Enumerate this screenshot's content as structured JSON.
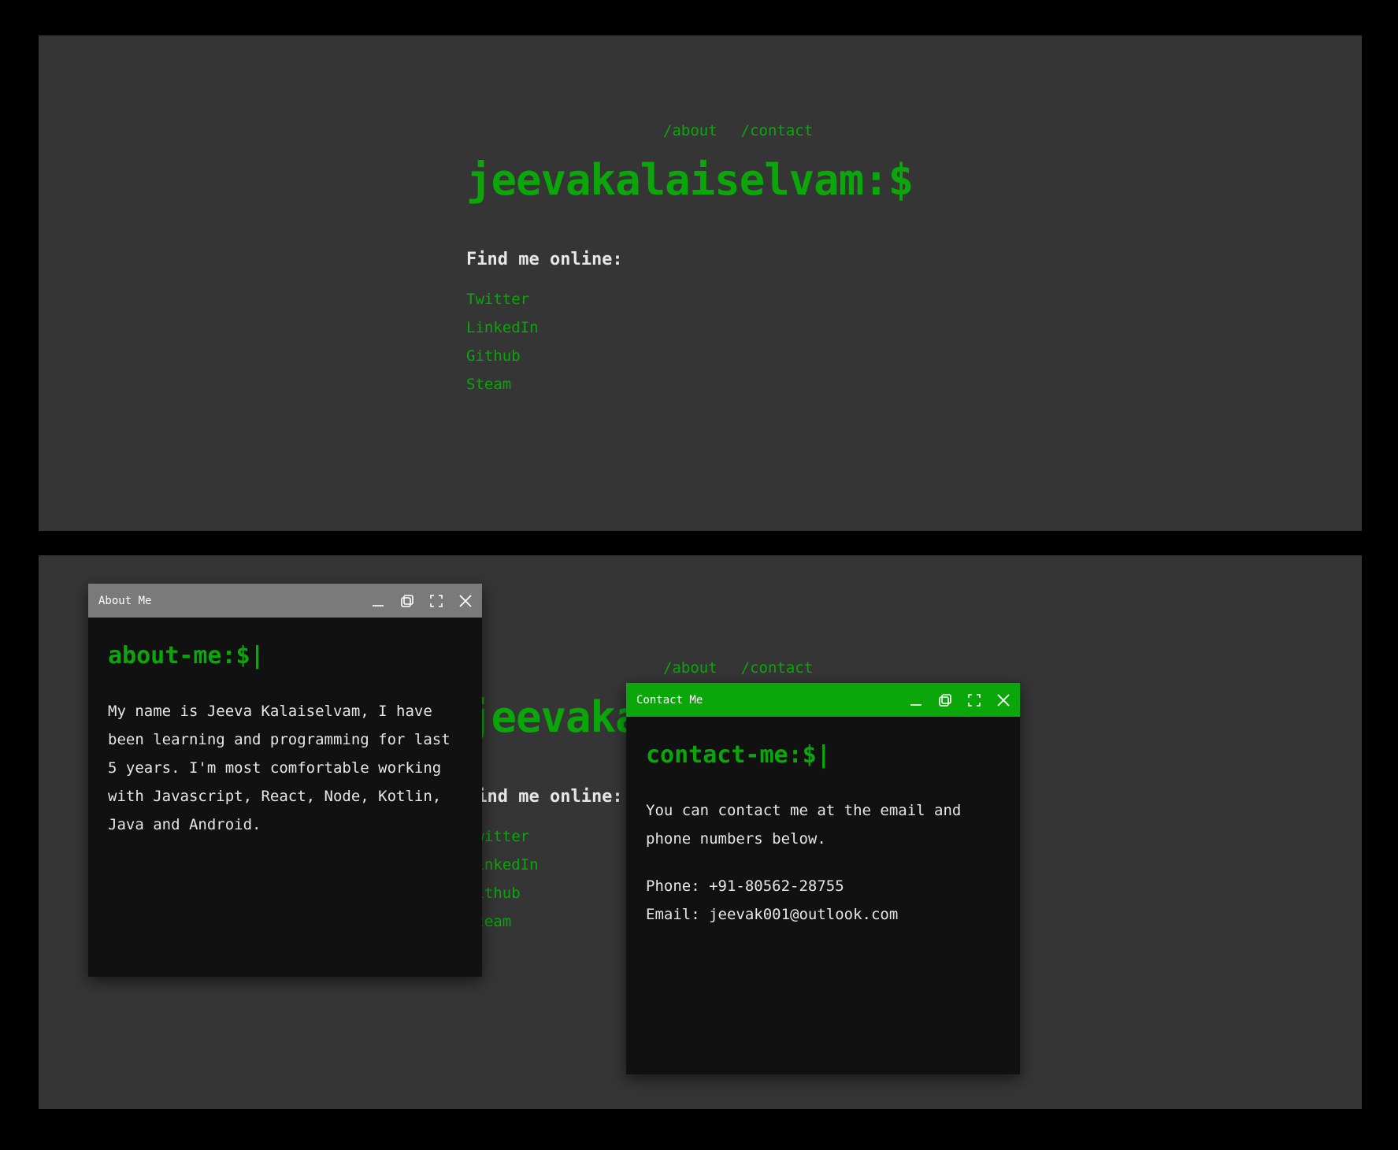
{
  "nav": {
    "about_label": "/about",
    "contact_label": "/contact"
  },
  "site": {
    "title": "jeevakalaiselvam:$",
    "find_heading": "Find me online:",
    "social_links": [
      "Twitter",
      "LinkedIn",
      "Github",
      "Steam"
    ]
  },
  "about_window": {
    "title": "About Me",
    "prompt": "about-me:$|",
    "text": "My name is Jeeva Kalaiselvam, I have been learning and programming for last 5 years. I'm most comfortable working with Javascript, React, Node, Kotlin, Java and Android."
  },
  "contact_window": {
    "title": "Contact Me",
    "prompt": "contact-me:$|",
    "text": "You can contact me at the email and phone numbers below.",
    "phone": "Phone: +91-80562-28755",
    "email": "Email: jeevak001@outlook.com"
  },
  "window_controls": [
    "minimize-icon",
    "restore-icon",
    "maximize-icon",
    "close-icon"
  ],
  "colors": {
    "accent": "#0aa60a",
    "page_background": "#353535",
    "window_background": "#111111",
    "inactive_titlebar": "#7a7a7a",
    "outer_background": "#000000"
  }
}
